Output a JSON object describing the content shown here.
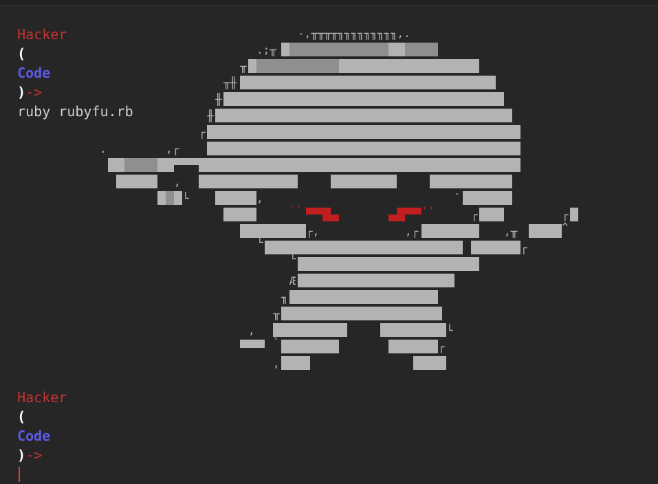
{
  "terminal": {
    "prompt": {
      "user": "Hacker",
      "open_paren": "(",
      "dir": "Code",
      "close_paren": ")",
      "arrow": "->"
    },
    "command": "ruby rubyfu.rb"
  },
  "art_fragments": [
    "-,╥╥╥╥╖╖╖╖╖╖╖╖╖,.",
    ".;╥",
    "╥",
    "╥╫",
    "╫",
    "╫",
    "┌",
    ".",
    ",┌",
    ",",
    "└",
    "`└",
    ",",
    "┌",
    "┌",
    "┌,",
    ",┌",
    ",╥",
    "^",
    "└",
    "┌",
    "└",
    "Æ",
    "╖",
    "╥",
    ",",
    "└",
    "`",
    "┌",
    ",",
    "''",
    "``"
  ],
  "colors": {
    "background": "#262626",
    "art_gray": "#b3b3b3",
    "art_red": "#c11f1f",
    "prompt_red": "#c83232",
    "prompt_blue": "#5b5bea"
  }
}
